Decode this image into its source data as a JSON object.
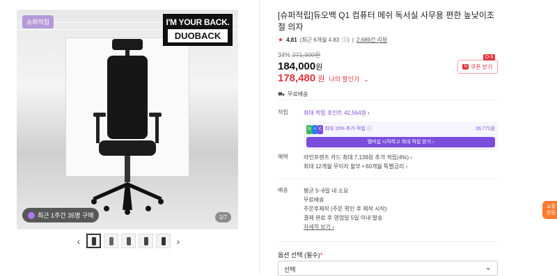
{
  "gallery": {
    "badge": "슈퍼적립",
    "brand_line1": "I'M YOUR BACK.",
    "brand_line2": "DUOBACK",
    "recent_purchase": "최근 1주간 35명 구매",
    "counter": "1/7",
    "thumb_count": 5
  },
  "product": {
    "title": "[슈퍼적립]듀오백 Q1 컴퓨터 메쉬 독서실 사무용 편한 높낮이조절 의자",
    "rating_score": "4.81",
    "rating_recent": "(최근 6개월 4.83",
    "review_count": "2,689건 리뷰",
    "discount_rate": "34%",
    "original_price": "271,300원",
    "price_value": "184,000",
    "price_unit": "원",
    "my_price_value": "178,480",
    "my_price_unit": "원",
    "my_price_label": "나의 할인가",
    "coupon_badge": "D-5",
    "coupon_label": "쿠폰 받기",
    "shipping_text": "무료배송"
  },
  "benefits": {
    "points_label": "적립",
    "points_text": "최대 적립 포인트 42,564원",
    "extra_text": "최대 15% 추가 적립",
    "extra_amount": "26,771원",
    "membership_button": "멤버십 시작하고 최대 적립 받기",
    "perks_label": "혜택",
    "perk1": "라인프렌즈 카드 최대 7,139원 추가 적립(4%)",
    "perk2": "최대 12개월 무이자 할부 • 60개월 특별금리"
  },
  "delivery": {
    "label": "배송",
    "line1": "평균 5~6일 내 소요",
    "line2": "무료배송",
    "line3": "주문후제작 (주문 확인 후 제작 시작)",
    "line4": "결제 완료 후 영업일 5일 이내 발송",
    "more_link": "자세히 보기"
  },
  "options": {
    "label": "옵션 선택 (필수)",
    "required_mark": "*",
    "select_value": "선택"
  },
  "float_tab": {
    "line1": "쇼핑",
    "line2": "찬원"
  },
  "colors": {
    "accent_red": "#e5343d",
    "accent_purple": "#7b4ddc",
    "float_orange": "#ff7a2e"
  }
}
